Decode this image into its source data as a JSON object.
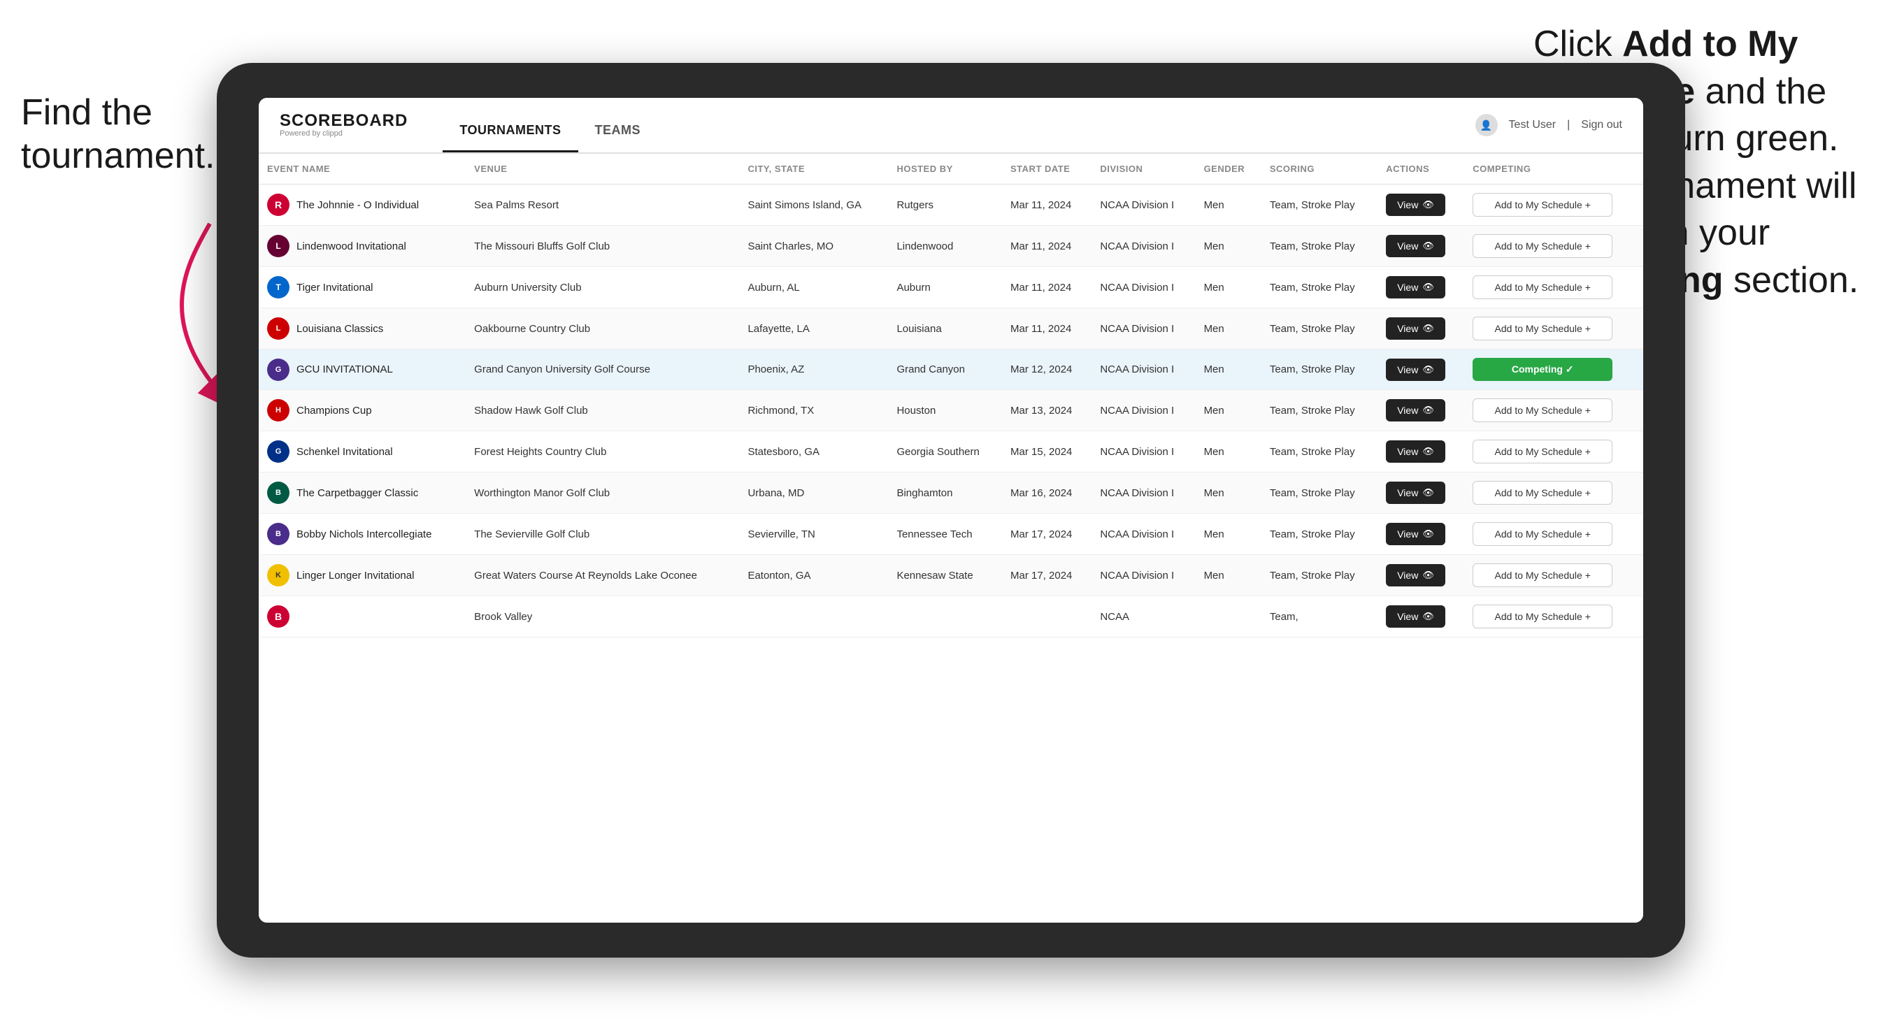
{
  "annotations": {
    "left": "Find the\ntournament.",
    "right_line1": "Click ",
    "right_bold1": "Add to My\nSchedule",
    "right_line2": " and the\nbox will turn green.\nThis tournament\nwill now be in\nyour ",
    "right_bold2": "Competing",
    "right_line3": "\nsection."
  },
  "app": {
    "logo": "SCOREBOARD",
    "logo_sub": "Powered by clippd",
    "user": "Test User",
    "sign_out": "Sign out"
  },
  "nav": {
    "tabs": [
      {
        "label": "TOURNAMENTS",
        "active": true
      },
      {
        "label": "TEAMS",
        "active": false
      }
    ]
  },
  "table": {
    "columns": [
      "EVENT NAME",
      "VENUE",
      "CITY, STATE",
      "HOSTED BY",
      "START DATE",
      "DIVISION",
      "GENDER",
      "SCORING",
      "ACTIONS",
      "COMPETING"
    ],
    "rows": [
      {
        "logo": "R",
        "logo_class": "logo-rutgers",
        "event": "The Johnnie - O Individual",
        "venue": "Sea Palms Resort",
        "city_state": "Saint Simons Island, GA",
        "hosted_by": "Rutgers",
        "start_date": "Mar 11, 2024",
        "division": "NCAA Division I",
        "gender": "Men",
        "scoring": "Team, Stroke Play",
        "action": "View",
        "competing": "Add to My Schedule +",
        "competing_type": "add",
        "highlighted": false
      },
      {
        "logo": "L",
        "logo_class": "logo-lindenwood",
        "event": "Lindenwood Invitational",
        "venue": "The Missouri Bluffs Golf Club",
        "city_state": "Saint Charles, MO",
        "hosted_by": "Lindenwood",
        "start_date": "Mar 11, 2024",
        "division": "NCAA Division I",
        "gender": "Men",
        "scoring": "Team, Stroke Play",
        "action": "View",
        "competing": "Add to My Schedule +",
        "competing_type": "add",
        "highlighted": false
      },
      {
        "logo": "T",
        "logo_class": "logo-auburn",
        "event": "Tiger Invitational",
        "venue": "Auburn University Club",
        "city_state": "Auburn, AL",
        "hosted_by": "Auburn",
        "start_date": "Mar 11, 2024",
        "division": "NCAA Division I",
        "gender": "Men",
        "scoring": "Team, Stroke Play",
        "action": "View",
        "competing": "Add to My Schedule +",
        "competing_type": "add",
        "highlighted": false
      },
      {
        "logo": "L",
        "logo_class": "logo-louisiana",
        "event": "Louisiana Classics",
        "venue": "Oakbourne Country Club",
        "city_state": "Lafayette, LA",
        "hosted_by": "Louisiana",
        "start_date": "Mar 11, 2024",
        "division": "NCAA Division I",
        "gender": "Men",
        "scoring": "Team, Stroke Play",
        "action": "View",
        "competing": "Add to My Schedule +",
        "competing_type": "add",
        "highlighted": false
      },
      {
        "logo": "G",
        "logo_class": "logo-gcu",
        "event": "GCU INVITATIONAL",
        "venue": "Grand Canyon University Golf Course",
        "city_state": "Phoenix, AZ",
        "hosted_by": "Grand Canyon",
        "start_date": "Mar 12, 2024",
        "division": "NCAA Division I",
        "gender": "Men",
        "scoring": "Team, Stroke Play",
        "action": "View",
        "competing": "Competing",
        "competing_type": "competing",
        "highlighted": true
      },
      {
        "logo": "H",
        "logo_class": "logo-houston",
        "event": "Champions Cup",
        "venue": "Shadow Hawk Golf Club",
        "city_state": "Richmond, TX",
        "hosted_by": "Houston",
        "start_date": "Mar 13, 2024",
        "division": "NCAA Division I",
        "gender": "Men",
        "scoring": "Team, Stroke Play",
        "action": "View",
        "competing": "Add to My Schedule +",
        "competing_type": "add",
        "highlighted": false
      },
      {
        "logo": "G",
        "logo_class": "logo-georgia-southern",
        "event": "Schenkel Invitational",
        "venue": "Forest Heights Country Club",
        "city_state": "Statesboro, GA",
        "hosted_by": "Georgia Southern",
        "start_date": "Mar 15, 2024",
        "division": "NCAA Division I",
        "gender": "Men",
        "scoring": "Team, Stroke Play",
        "action": "View",
        "competing": "Add to My Schedule +",
        "competing_type": "add",
        "highlighted": false
      },
      {
        "logo": "B",
        "logo_class": "logo-binghamton",
        "event": "The Carpetbagger Classic",
        "venue": "Worthington Manor Golf Club",
        "city_state": "Urbana, MD",
        "hosted_by": "Binghamton",
        "start_date": "Mar 16, 2024",
        "division": "NCAA Division I",
        "gender": "Men",
        "scoring": "Team, Stroke Play",
        "action": "View",
        "competing": "Add to My Schedule +",
        "competing_type": "add",
        "highlighted": false
      },
      {
        "logo": "B",
        "logo_class": "logo-tennessee-tech",
        "event": "Bobby Nichols Intercollegiate",
        "venue": "The Sevierville Golf Club",
        "city_state": "Sevierville, TN",
        "hosted_by": "Tennessee Tech",
        "start_date": "Mar 17, 2024",
        "division": "NCAA Division I",
        "gender": "Men",
        "scoring": "Team, Stroke Play",
        "action": "View",
        "competing": "Add to My Schedule +",
        "competing_type": "add",
        "highlighted": false
      },
      {
        "logo": "K",
        "logo_class": "logo-kennesaw",
        "event": "Linger Longer Invitational",
        "venue": "Great Waters Course At Reynolds Lake Oconee",
        "city_state": "Eatonton, GA",
        "hosted_by": "Kennesaw State",
        "start_date": "Mar 17, 2024",
        "division": "NCAA Division I",
        "gender": "Men",
        "scoring": "Team, Stroke Play",
        "action": "View",
        "competing": "Add to My Schedule +",
        "competing_type": "add",
        "highlighted": false
      },
      {
        "logo": "B",
        "logo_class": "logo-rutgers",
        "event": "",
        "venue": "Brook Valley",
        "city_state": "",
        "hosted_by": "",
        "start_date": "",
        "division": "NCAA",
        "gender": "",
        "scoring": "Team,",
        "action": "View",
        "competing": "Add to My Schedule +",
        "competing_type": "add",
        "highlighted": false
      }
    ]
  }
}
